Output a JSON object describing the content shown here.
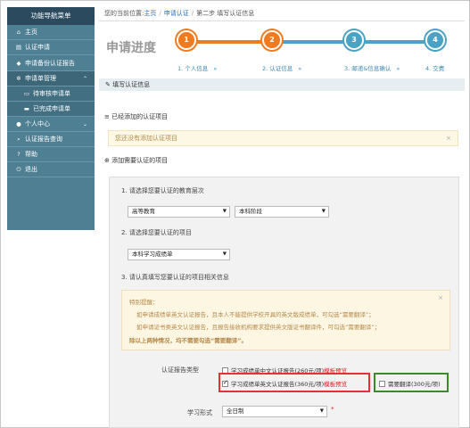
{
  "sidebar": {
    "title": "功能导航菜单",
    "items": [
      {
        "label": "主页",
        "icon": "home-icon"
      },
      {
        "label": "认证申请",
        "icon": "file-icon"
      },
      {
        "label": "申请备份认证报告",
        "icon": "tag-icon"
      },
      {
        "label": "申请单管理",
        "icon": "gear-icon"
      },
      {
        "label": "待审核申请单",
        "icon": "inbox-icon"
      },
      {
        "label": "已完成申请单",
        "icon": "briefcase-icon"
      },
      {
        "label": "个人中心",
        "icon": "user-icon"
      },
      {
        "label": "认证报告查询",
        "icon": "search-icon"
      },
      {
        "label": "帮助",
        "icon": "help-icon"
      },
      {
        "label": "退出",
        "icon": "power-icon"
      }
    ]
  },
  "breadcrumb": {
    "prefix": "您的当前位置:",
    "home": "主页",
    "apply": "申请认证",
    "current": "第二步 填写认证信息"
  },
  "steps": {
    "title": "申请进度",
    "items": [
      {
        "num": "1",
        "label": "1. 个人信息"
      },
      {
        "num": "2",
        "label": "2. 认证信息"
      },
      {
        "num": "3",
        "label": "3. 邮递&信息确认"
      },
      {
        "num": "4",
        "label": "4. 交费"
      }
    ],
    "arrow": "»"
  },
  "panel": {
    "title": "填写认证信息",
    "added_title": "已经添加的认证项目",
    "empty_notice": "您还没有添加认证项目",
    "add_title": "添加需要认证的项目"
  },
  "form": {
    "q1": "1. 请选择您要认证的教育层次",
    "level1": "高等教育",
    "level2": "本科阶段",
    "q2": "2. 请选择您要认证的项目",
    "item": "本科学习成绩单",
    "q3": "3. 请认真填写您要认证的项目相关信息",
    "tips_title": "特别提醒：",
    "tip1": "如申请成绩单英文认证报告，且本人不能提供学校开具的英文版成绩单，可勾选“需要翻译”；",
    "tip2": "如申请证书类英文认证报告，且报告接收机构要求提供英文版证书翻译件，可勾选“需要翻译”；",
    "tip3": "除以上两种情况，均不需要勾选“需要翻译”。",
    "report_type_label": "认证报告类型",
    "opt_cn": "学习成绩单中文认证报告(260元/项)",
    "opt_en": "学习成绩单英文认证报告(360元/项)",
    "template_preview": "模板预览",
    "translate": "需要翻译(300元/项)",
    "study_form_label": "学习形式",
    "study_form": "全日制",
    "required_mark": "*"
  },
  "colors": {
    "sidebar": "#4f7f93",
    "sidebar_header": "#2b4a5e",
    "step_done": "#f07a1e",
    "step_todo": "#4aa3c4",
    "highlight_red": "#e53131",
    "highlight_green": "#3a8a2a"
  }
}
